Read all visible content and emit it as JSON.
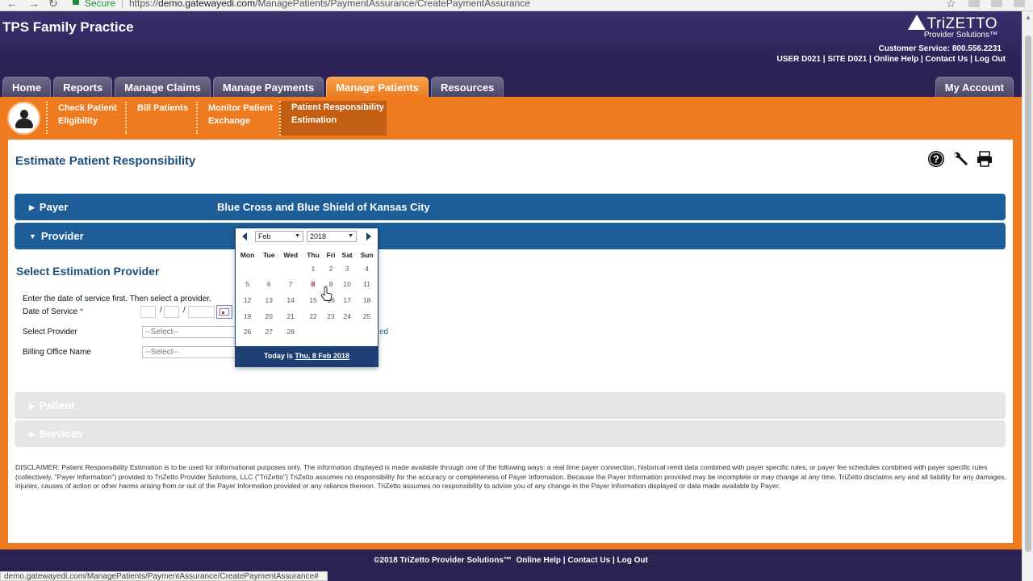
{
  "browser": {
    "secure_label": "Secure",
    "url_scheme": "https://",
    "url_host": "demo.gatewayedi.com",
    "url_path": "/ManagePatients/PaymentAssurance/CreatePaymentAssurance"
  },
  "header": {
    "practice_name": "TPS Family Practice",
    "logo_brand": "TriZETTO",
    "logo_sub": "Provider Solutions™",
    "customer_service": "Customer Service: 800.556.2231",
    "user_links": "USER D021 | SITE D021 | Online Help | Contact Us | Log Out"
  },
  "tabs": {
    "home": "Home",
    "reports": "Reports",
    "manage_claims": "Manage Claims",
    "manage_payments": "Manage Payments",
    "manage_patients": "Manage Patients",
    "resources": "Resources",
    "my_account": "My Account"
  },
  "subnav": {
    "check_eligibility_1": "Check Patient",
    "check_eligibility_2": "Eligibility",
    "bill_patients": "Bill Patients",
    "monitor_1": "Monitor Patient",
    "monitor_2": "Exchange",
    "estimation_1": "Patient Responsibility",
    "estimation_2": "Estimation"
  },
  "page": {
    "title": "Estimate Patient Responsibility"
  },
  "payer_bar": {
    "label": "Payer",
    "value": "Blue Cross and Blue Shield of Kansas City"
  },
  "provider_bar": {
    "label": "Provider"
  },
  "provider_form": {
    "section_title": "Select Estimation Provider",
    "instruction": "Enter the date of service first. Then select a provider.",
    "date_label": "Date of Service",
    "required_mark": "*",
    "date_sep": "/",
    "provider_label": "Select Provider",
    "provider_placeholder": "--Select--",
    "billing_label": "Billing Office Name",
    "billing_placeholder": "--Select--",
    "partial_link": "ed"
  },
  "patient_bar": {
    "label": "Patient"
  },
  "services_bar": {
    "label": "Services"
  },
  "disclaimer": "DISCLAIMER: Patient Responsibility Estimation is to be used for informational purposes only. The information displayed is made available through one of the following ways: a real time payer connection, historical remit data combined with payer specific rules, or payer fee schedules combined with payer specific rules (collectively, \"Payer Information\") provided to TriZetto Provider Solutions, LLC (\"TriZetto\") TriZetto assumes no responsibility for the accuracy or completeness of Payer Information. Because the Payer Information provided may be incomplete or may change at any time, TriZetto disclaims any and all liability for any damages, injuries, causes of action or other harms arising from or out of the Payer Information provided or any reliance thereon. TriZetto assumes no responsibility to advise you of any change in the Payer Information displayed or data made available by Payer.",
  "calendar": {
    "month": "Feb",
    "year": "2018",
    "weekdays": [
      "Mon",
      "Tue",
      "Wed",
      "Thu",
      "Fri",
      "Sat",
      "Sun"
    ],
    "weeks": [
      [
        "",
        "",
        "",
        "1",
        "2",
        "3",
        "4"
      ],
      [
        "5",
        "6",
        "7",
        "8",
        "9",
        "10",
        "11"
      ],
      [
        "12",
        "13",
        "14",
        "15",
        "16",
        "17",
        "18"
      ],
      [
        "19",
        "20",
        "21",
        "22",
        "23",
        "24",
        "25"
      ],
      [
        "26",
        "27",
        "28",
        "",
        "",
        "",
        ""
      ]
    ],
    "today_day": "8",
    "today_prefix": "Today is",
    "today_link": "Thu, 8 Feb 2018"
  },
  "footer": {
    "text": "©2018 TriZetto Provider Solutions™",
    "links": "Online Help | Contact Us | Log Out"
  },
  "status_bar": {
    "url": "demo.gatewayedi.com/ManagePatients/PaymentAssurance/CreatePaymentAssurance#"
  },
  "colors": {
    "header_bg": "#2b2357",
    "accent_orange": "#ee7b1f",
    "bar_blue": "#1d5e98",
    "calendar_navy": "#1d3f73"
  }
}
